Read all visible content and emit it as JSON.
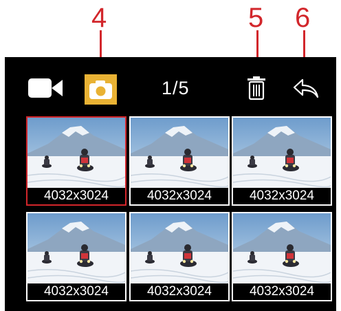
{
  "colors": {
    "callout": "#d2262b",
    "accent": "#e9b234",
    "screen_bg": "#000000",
    "selected_border": "#d2262b",
    "thumb_border": "#ffffff"
  },
  "callouts": [
    {
      "number": "4",
      "target": "photo-mode-icon"
    },
    {
      "number": "5",
      "target": "trash-icon"
    },
    {
      "number": "6",
      "target": "back-arrow-icon"
    }
  ],
  "toolbar": {
    "video_mode_icon": "video-camera-icon",
    "photo_mode_icon": "camera-icon",
    "photo_mode_active": true,
    "counter": "1/5",
    "delete_icon": "trash-icon",
    "back_icon": "back-arrow-icon"
  },
  "thumbnails": [
    {
      "resolution": "4032x3024",
      "selected": true
    },
    {
      "resolution": "4032x3024",
      "selected": false
    },
    {
      "resolution": "4032x3024",
      "selected": false
    },
    {
      "resolution": "4032x3024",
      "selected": false
    },
    {
      "resolution": "4032x3024",
      "selected": false
    },
    {
      "resolution": "4032x3024",
      "selected": false
    }
  ]
}
